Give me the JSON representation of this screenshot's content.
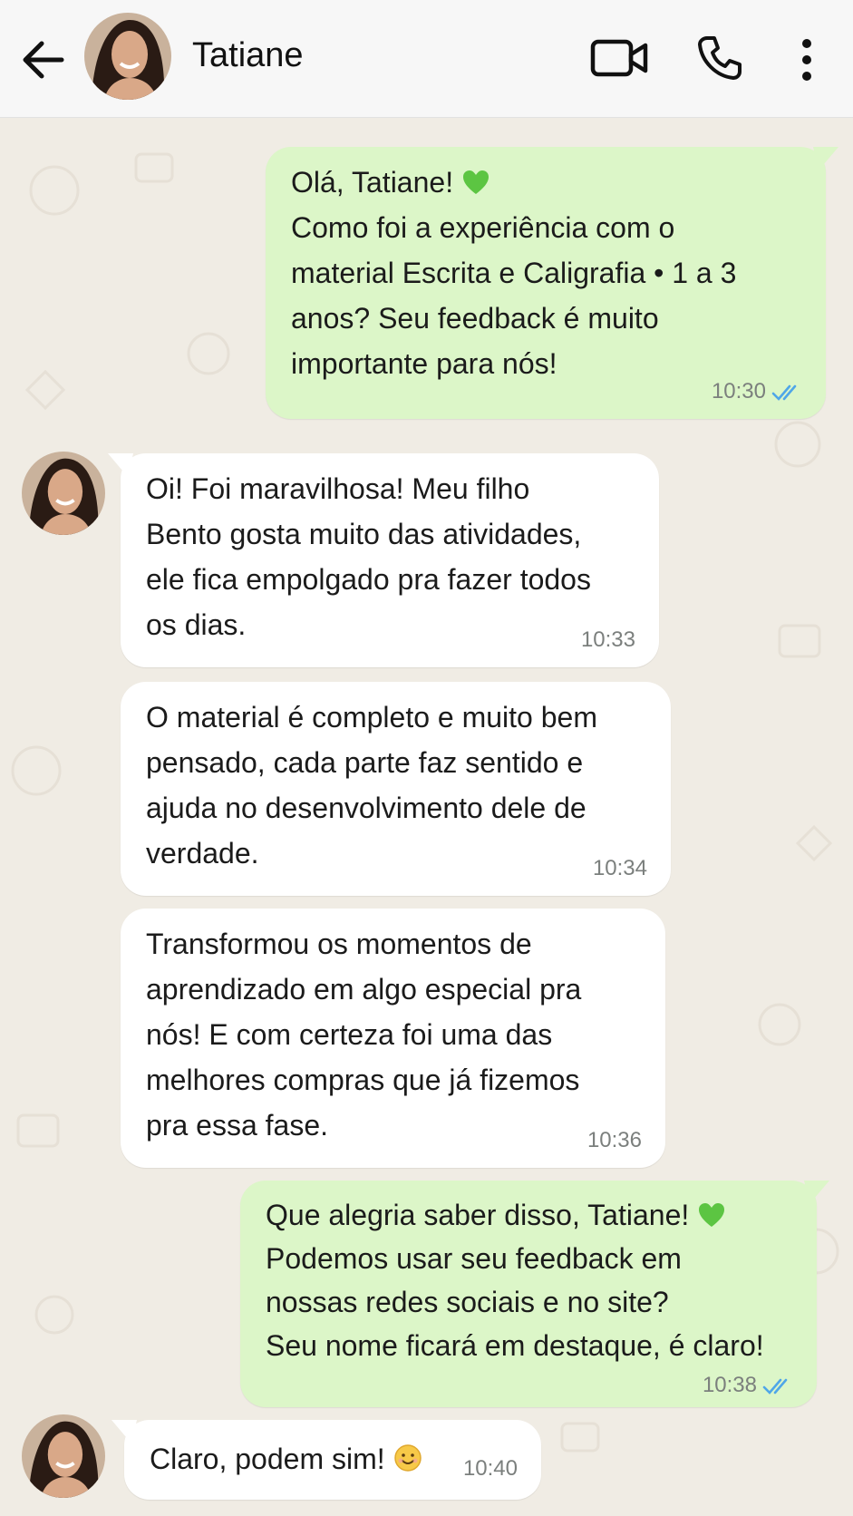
{
  "header": {
    "contact_name": "Tatiane",
    "icons": [
      "back-arrow-icon",
      "video-call-icon",
      "phone-icon",
      "more-vertical-icon"
    ]
  },
  "messages": [
    {
      "direction": "out",
      "lines": "Olá, Tatiane!",
      "emoji": "green-heart",
      "body": "Como foi a experiência com o\nmaterial Escrita e Caligrafia • 1 a 3\nanos? Seu feedback é muito\nimportante para nós!",
      "time": "10:30",
      "read": true
    },
    {
      "direction": "in",
      "body": "Oi! Foi maravilhosa! Meu filho\nBento gosta muito das atividades,\nele fica empolgado pra fazer todos\nos dias.",
      "time": "10:33"
    },
    {
      "direction": "in",
      "body": "O material é completo e muito bem\npensado, cada parte faz sentido e\najuda no desenvolvimento dele de\nverdade.",
      "time": "10:34"
    },
    {
      "direction": "in",
      "body": "Transformou os momentos de\naprendizado em algo especial pra\nnós! E com certeza foi uma das\nmelhores compras que já fizemos\npra essa fase.",
      "time": "10:36"
    },
    {
      "direction": "out",
      "lines": "Que alegria saber disso, Tatiane!",
      "emoji": "green-heart",
      "body": "Podemos usar seu feedback em\nnossas redes sociais e no site?\nSeu nome ficará em destaque, é claro!",
      "time": "10:38",
      "read": true
    },
    {
      "direction": "in",
      "lines": "Claro, podem sim!",
      "emoji": "smiling-face",
      "time": "10:40"
    }
  ],
  "colors": {
    "outgoing_bubble": "#dcf6c8",
    "incoming_bubble": "#ffffff",
    "chat_background": "#f0ece4",
    "read_ticks": "#4fa6e8"
  }
}
